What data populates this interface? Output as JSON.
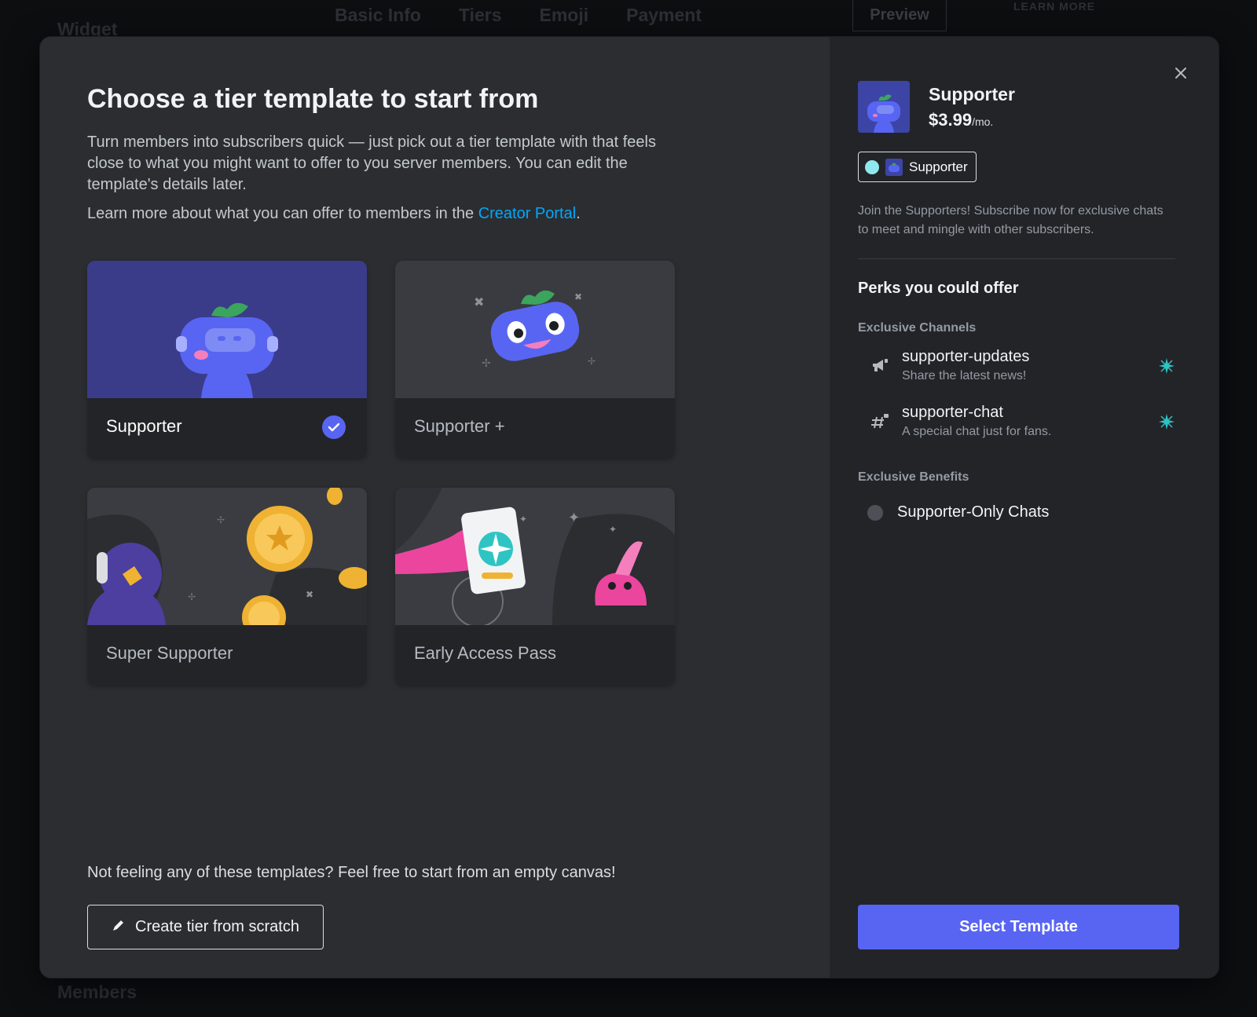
{
  "background": {
    "widget_label": "Widget",
    "members_label": "Members",
    "tabs": [
      "Basic Info",
      "Tiers",
      "Emoji",
      "Payment"
    ],
    "preview_label": "Preview",
    "learn_more_label": "LEARN MORE"
  },
  "modal": {
    "title": "Choose a tier template to start from",
    "description": "Turn members into subscribers quick — just pick out a tier template with that feels close to what you might want to offer to you server members. You can edit the template's details later.",
    "learn_prefix": "Learn more about what you can offer to members in the ",
    "learn_link": "Creator Portal",
    "learn_suffix": ".",
    "templates": [
      {
        "label": "Supporter",
        "selected": true
      },
      {
        "label": "Supporter +",
        "selected": false
      },
      {
        "label": "Super Supporter",
        "selected": false
      },
      {
        "label": "Early Access Pass",
        "selected": false
      }
    ],
    "bottom_note": "Not feeling any of these templates? Feel free to start from an empty canvas!",
    "scratch_button": "Create tier from scratch"
  },
  "preview": {
    "tier_name": "Supporter",
    "price": "$3.99",
    "price_unit": "/mo.",
    "role_chip": "Supporter",
    "role_color": "#8ee8ee",
    "description": "Join the Supporters! Subscribe now for exclusive chats to meet and mingle with other subscribers.",
    "perks_title": "Perks you could offer",
    "channels_heading": "Exclusive Channels",
    "channels": [
      {
        "name": "supporter-updates",
        "desc": "Share the latest news!",
        "icon": "megaphone-icon"
      },
      {
        "name": "supporter-chat",
        "desc": "A special chat just for fans.",
        "icon": "locked-hashtag-icon"
      }
    ],
    "benefits_heading": "Exclusive Benefits",
    "benefits": [
      {
        "name": "Supporter-Only Chats"
      }
    ],
    "select_button": "Select Template"
  },
  "colors": {
    "accent": "#5865f2",
    "link": "#00a8fc",
    "spark": "#2fc4c4"
  }
}
